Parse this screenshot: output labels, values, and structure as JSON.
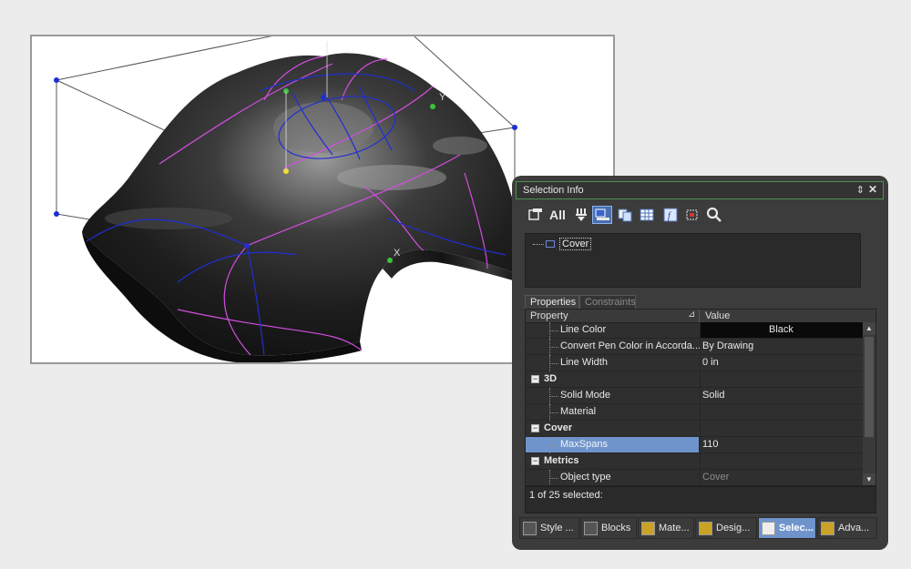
{
  "panel": {
    "title": "Selection Info",
    "pin_glyph": "⇕",
    "close_glyph": "✕",
    "toolbar": {
      "all_label": "All",
      "icons": [
        "properties-icon",
        "all-icon",
        "filter-icon",
        "selection-mode-icon",
        "copy-icon",
        "table-icon",
        "function-icon",
        "select-region-icon",
        "search-icon"
      ]
    },
    "tree": {
      "item_label": "Cover"
    },
    "tabs": [
      {
        "label": "Properties",
        "active": true
      },
      {
        "label": "Constraints",
        "active": false
      }
    ],
    "grid": {
      "header_property": "Property",
      "header_value": "Value",
      "sort_glyph": "⊿",
      "rows": [
        {
          "type": "prop",
          "label": "Line Color",
          "value": "Black"
        },
        {
          "type": "prop",
          "label": "Convert Pen Color in Accorda...",
          "value": "By Drawing"
        },
        {
          "type": "prop",
          "label": "Line Width",
          "value": "0 in"
        },
        {
          "type": "cat",
          "label": "3D",
          "value": ""
        },
        {
          "type": "prop",
          "label": "Solid Mode",
          "value": "Solid"
        },
        {
          "type": "prop",
          "label": "Material",
          "value": ""
        },
        {
          "type": "cat",
          "label": "Cover",
          "value": ""
        },
        {
          "type": "prop",
          "label": "MaxSpans",
          "value": "110"
        },
        {
          "type": "cat",
          "label": "Metrics",
          "value": ""
        },
        {
          "type": "prop",
          "label": "Object type",
          "value": "Cover"
        }
      ]
    },
    "status": "1 of 25 selected:",
    "bottom_tabs": [
      {
        "label": "Style ...",
        "active": false
      },
      {
        "label": "Blocks",
        "active": false
      },
      {
        "label": "Mate...",
        "active": false
      },
      {
        "label": "Desig...",
        "active": false
      },
      {
        "label": "Selec...",
        "active": true
      },
      {
        "label": "Adva...",
        "active": false
      }
    ]
  },
  "viewport": {
    "axis_y_label": "Y",
    "axis_x_label": "X"
  },
  "colors": {
    "accent": "#6f94cc",
    "panel_bg": "#3c3c3c",
    "curve_magenta": "#d34ee0",
    "curve_blue": "#1f2ed2"
  }
}
